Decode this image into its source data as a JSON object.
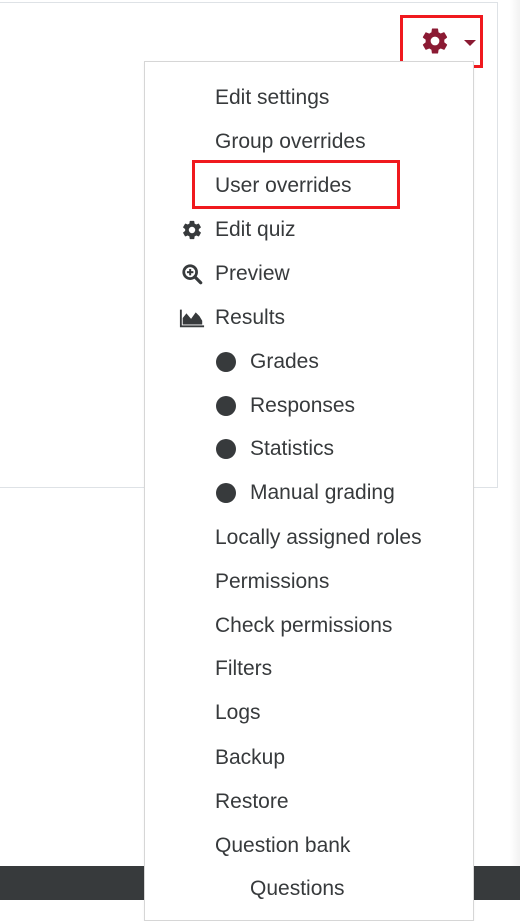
{
  "colors": {
    "accent": "#8b1a33",
    "highlight": "#f0191e",
    "text": "#373a3c",
    "footer": "#373a3c"
  },
  "actions_menu": {
    "trigger_icon": "gear-icon",
    "caret_icon": "caret-down-icon",
    "items": [
      {
        "label": "Edit settings",
        "icon": null,
        "level": 0
      },
      {
        "label": "Group overrides",
        "icon": null,
        "level": 0
      },
      {
        "label": "User overrides",
        "icon": null,
        "level": 0,
        "highlighted": true
      },
      {
        "label": "Edit quiz",
        "icon": "gear-icon",
        "level": 0
      },
      {
        "label": "Preview",
        "icon": "zoom-in-icon",
        "level": 0
      },
      {
        "label": "Results",
        "icon": "area-chart-icon",
        "level": 0
      },
      {
        "label": "Grades",
        "icon": "bullet-icon",
        "level": 1
      },
      {
        "label": "Responses",
        "icon": "bullet-icon",
        "level": 1
      },
      {
        "label": "Statistics",
        "icon": "bullet-icon",
        "level": 1
      },
      {
        "label": "Manual grading",
        "icon": "bullet-icon",
        "level": 1
      },
      {
        "label": "Locally assigned roles",
        "icon": null,
        "level": 0
      },
      {
        "label": "Permissions",
        "icon": null,
        "level": 0
      },
      {
        "label": "Check permissions",
        "icon": null,
        "level": 0
      },
      {
        "label": "Filters",
        "icon": null,
        "level": 0
      },
      {
        "label": "Logs",
        "icon": null,
        "level": 0
      },
      {
        "label": "Backup",
        "icon": null,
        "level": 0
      },
      {
        "label": "Restore",
        "icon": null,
        "level": 0
      },
      {
        "label": "Question bank",
        "icon": null,
        "level": 0
      },
      {
        "label": "Questions",
        "icon": null,
        "level": 1
      }
    ]
  }
}
